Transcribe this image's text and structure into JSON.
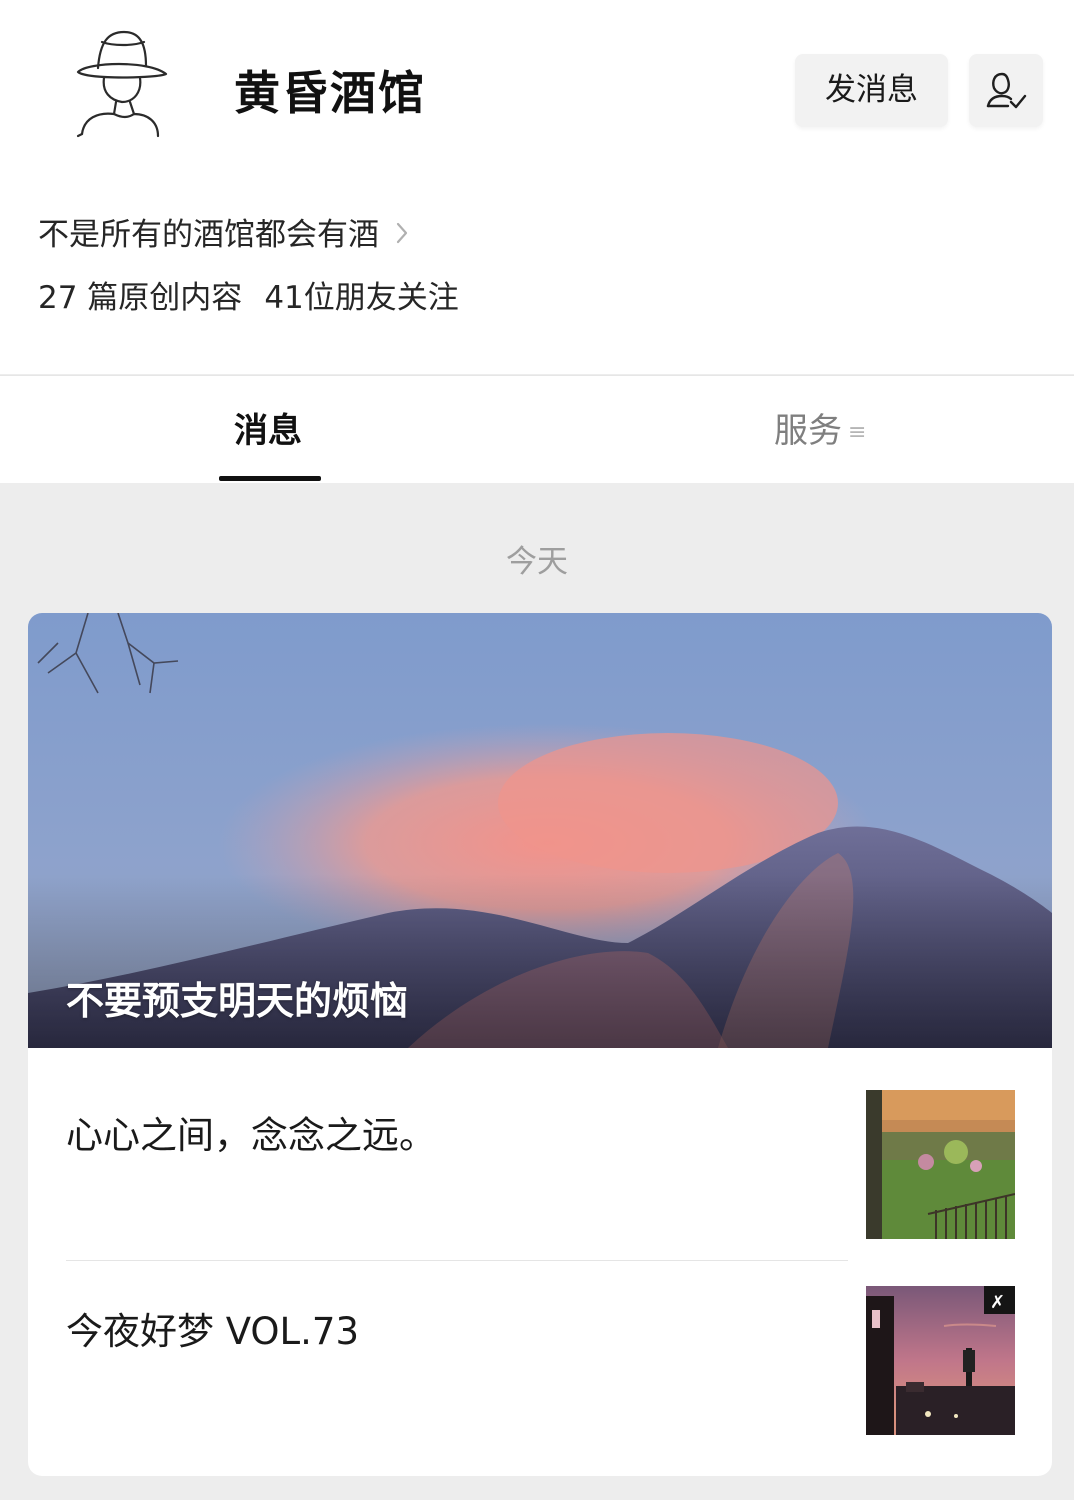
{
  "profile": {
    "name": "黄昏酒馆",
    "description": "不是所有的酒馆都会有酒",
    "stats": {
      "articles": "27 篇原创内容",
      "followers": "41位朋友关注"
    },
    "send_message_label": "发消息",
    "avatar_icon": "hat-figure-avatar-icon",
    "follow_icon": "person-check-icon"
  },
  "tabs": [
    {
      "label": "消息",
      "active": true
    },
    {
      "label": "服务",
      "active": false
    }
  ],
  "feed": {
    "date_label": "今天",
    "cover": {
      "title": "不要预支明天的烦恼"
    },
    "items": [
      {
        "title": "心心之间，念念之远。"
      },
      {
        "title": "今夜好梦 VOL.73"
      }
    ]
  },
  "colors": {
    "background": "#ededed",
    "card": "#ffffff",
    "text_primary": "#191919",
    "text_secondary": "#7f7f7f",
    "tab_underline": "#111111"
  }
}
